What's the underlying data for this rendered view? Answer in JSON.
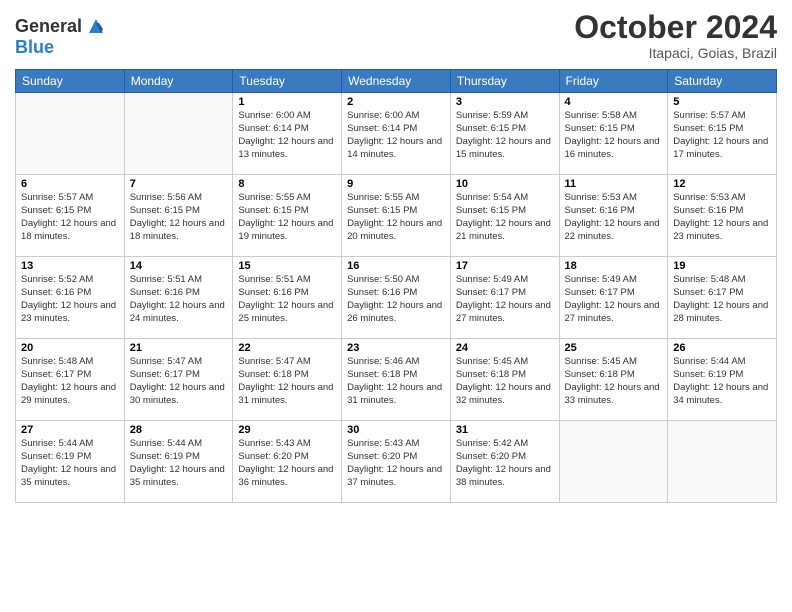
{
  "header": {
    "logo_line1": "General",
    "logo_line2": "Blue",
    "month_title": "October 2024",
    "subtitle": "Itapaci, Goias, Brazil"
  },
  "days_of_week": [
    "Sunday",
    "Monday",
    "Tuesday",
    "Wednesday",
    "Thursday",
    "Friday",
    "Saturday"
  ],
  "weeks": [
    [
      {
        "day": "",
        "info": ""
      },
      {
        "day": "",
        "info": ""
      },
      {
        "day": "1",
        "info": "Sunrise: 6:00 AM\nSunset: 6:14 PM\nDaylight: 12 hours and 13 minutes."
      },
      {
        "day": "2",
        "info": "Sunrise: 6:00 AM\nSunset: 6:14 PM\nDaylight: 12 hours and 14 minutes."
      },
      {
        "day": "3",
        "info": "Sunrise: 5:59 AM\nSunset: 6:15 PM\nDaylight: 12 hours and 15 minutes."
      },
      {
        "day": "4",
        "info": "Sunrise: 5:58 AM\nSunset: 6:15 PM\nDaylight: 12 hours and 16 minutes."
      },
      {
        "day": "5",
        "info": "Sunrise: 5:57 AM\nSunset: 6:15 PM\nDaylight: 12 hours and 17 minutes."
      }
    ],
    [
      {
        "day": "6",
        "info": "Sunrise: 5:57 AM\nSunset: 6:15 PM\nDaylight: 12 hours and 18 minutes."
      },
      {
        "day": "7",
        "info": "Sunrise: 5:56 AM\nSunset: 6:15 PM\nDaylight: 12 hours and 18 minutes."
      },
      {
        "day": "8",
        "info": "Sunrise: 5:55 AM\nSunset: 6:15 PM\nDaylight: 12 hours and 19 minutes."
      },
      {
        "day": "9",
        "info": "Sunrise: 5:55 AM\nSunset: 6:15 PM\nDaylight: 12 hours and 20 minutes."
      },
      {
        "day": "10",
        "info": "Sunrise: 5:54 AM\nSunset: 6:15 PM\nDaylight: 12 hours and 21 minutes."
      },
      {
        "day": "11",
        "info": "Sunrise: 5:53 AM\nSunset: 6:16 PM\nDaylight: 12 hours and 22 minutes."
      },
      {
        "day": "12",
        "info": "Sunrise: 5:53 AM\nSunset: 6:16 PM\nDaylight: 12 hours and 23 minutes."
      }
    ],
    [
      {
        "day": "13",
        "info": "Sunrise: 5:52 AM\nSunset: 6:16 PM\nDaylight: 12 hours and 23 minutes."
      },
      {
        "day": "14",
        "info": "Sunrise: 5:51 AM\nSunset: 6:16 PM\nDaylight: 12 hours and 24 minutes."
      },
      {
        "day": "15",
        "info": "Sunrise: 5:51 AM\nSunset: 6:16 PM\nDaylight: 12 hours and 25 minutes."
      },
      {
        "day": "16",
        "info": "Sunrise: 5:50 AM\nSunset: 6:16 PM\nDaylight: 12 hours and 26 minutes."
      },
      {
        "day": "17",
        "info": "Sunrise: 5:49 AM\nSunset: 6:17 PM\nDaylight: 12 hours and 27 minutes."
      },
      {
        "day": "18",
        "info": "Sunrise: 5:49 AM\nSunset: 6:17 PM\nDaylight: 12 hours and 27 minutes."
      },
      {
        "day": "19",
        "info": "Sunrise: 5:48 AM\nSunset: 6:17 PM\nDaylight: 12 hours and 28 minutes."
      }
    ],
    [
      {
        "day": "20",
        "info": "Sunrise: 5:48 AM\nSunset: 6:17 PM\nDaylight: 12 hours and 29 minutes."
      },
      {
        "day": "21",
        "info": "Sunrise: 5:47 AM\nSunset: 6:17 PM\nDaylight: 12 hours and 30 minutes."
      },
      {
        "day": "22",
        "info": "Sunrise: 5:47 AM\nSunset: 6:18 PM\nDaylight: 12 hours and 31 minutes."
      },
      {
        "day": "23",
        "info": "Sunrise: 5:46 AM\nSunset: 6:18 PM\nDaylight: 12 hours and 31 minutes."
      },
      {
        "day": "24",
        "info": "Sunrise: 5:45 AM\nSunset: 6:18 PM\nDaylight: 12 hours and 32 minutes."
      },
      {
        "day": "25",
        "info": "Sunrise: 5:45 AM\nSunset: 6:18 PM\nDaylight: 12 hours and 33 minutes."
      },
      {
        "day": "26",
        "info": "Sunrise: 5:44 AM\nSunset: 6:19 PM\nDaylight: 12 hours and 34 minutes."
      }
    ],
    [
      {
        "day": "27",
        "info": "Sunrise: 5:44 AM\nSunset: 6:19 PM\nDaylight: 12 hours and 35 minutes."
      },
      {
        "day": "28",
        "info": "Sunrise: 5:44 AM\nSunset: 6:19 PM\nDaylight: 12 hours and 35 minutes."
      },
      {
        "day": "29",
        "info": "Sunrise: 5:43 AM\nSunset: 6:20 PM\nDaylight: 12 hours and 36 minutes."
      },
      {
        "day": "30",
        "info": "Sunrise: 5:43 AM\nSunset: 6:20 PM\nDaylight: 12 hours and 37 minutes."
      },
      {
        "day": "31",
        "info": "Sunrise: 5:42 AM\nSunset: 6:20 PM\nDaylight: 12 hours and 38 minutes."
      },
      {
        "day": "",
        "info": ""
      },
      {
        "day": "",
        "info": ""
      }
    ]
  ]
}
